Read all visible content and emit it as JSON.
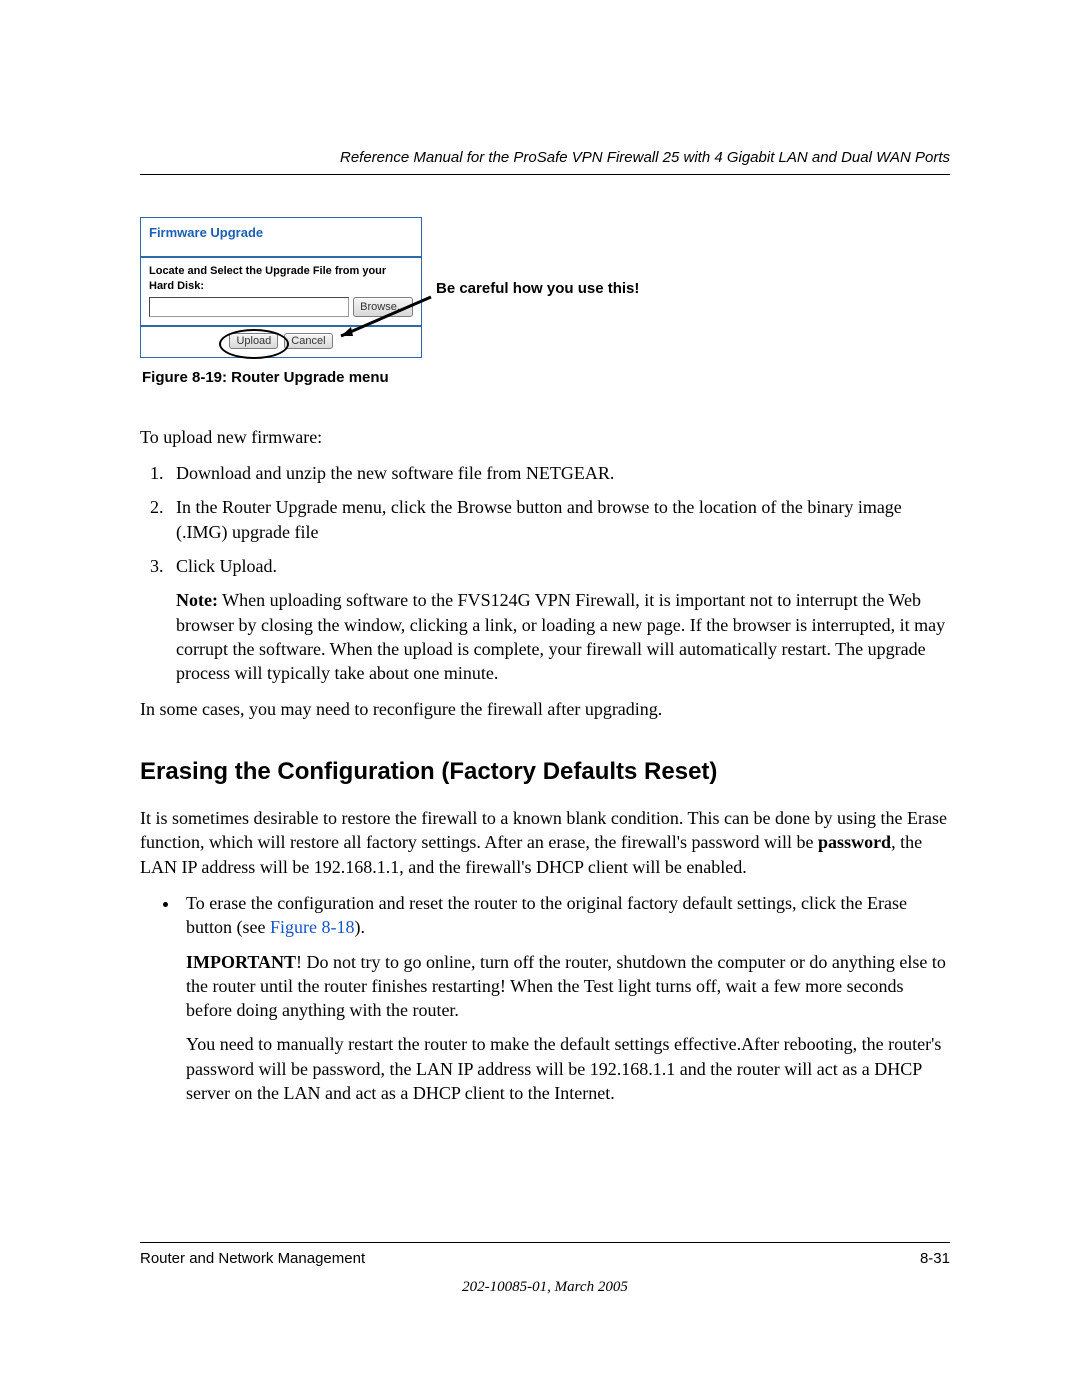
{
  "header": {
    "running_head": "Reference Manual for the ProSafe VPN Firewall 25 with 4 Gigabit LAN and Dual WAN Ports"
  },
  "screenshot": {
    "title": "Firmware Upgrade",
    "locate_label": "Locate and Select the Upgrade File from your Hard Disk:",
    "browse_btn": "Browse...",
    "upload_btn": "Upload",
    "cancel_btn": "Cancel"
  },
  "callout": "Be careful how you use this!",
  "figure_caption": "Figure 8-19:  Router Upgrade menu",
  "intro": "To upload new firmware:",
  "steps": {
    "s1": "Download and unzip the new software file from NETGEAR.",
    "s2": "In the Router Upgrade menu, click the Browse button and browse to the location of the binary image (.IMG) upgrade file",
    "s3": "Click Upload.",
    "s3_note_label": "Note:",
    "s3_note_body": " When uploading software to the FVS124G VPN Firewall, it is important not to interrupt the Web browser by closing the window, clicking a link, or loading a new page. If the browser is interrupted, it may corrupt the software. When the upload is complete, your firewall will automatically restart. The upgrade process will typically take about one minute."
  },
  "after_steps": "In some cases, you may need to reconfigure the firewall after upgrading.",
  "section_heading": "Erasing the Configuration (Factory Defaults Reset)",
  "section_para_pre": "It is sometimes desirable to restore the firewall to a known blank condition. This can be done by using the Erase function, which will restore all factory settings. After an erase, the firewall's password will be ",
  "section_para_bold": "password",
  "section_para_post": ", the LAN IP address will be 192.168.1.1, and the firewall's DHCP client will be enabled.",
  "bullet": {
    "lead": "To erase the configuration and reset the router to the original factory default settings, click the Erase button (see ",
    "link_text": "Figure 8-18",
    "lead_end": ").",
    "important_label": "IMPORTANT",
    "important_body": "! Do not try to go online, turn off the router, shutdown the computer or do anything else to the router until the router finishes restarting! When the Test light turns off, wait a few more seconds before doing anything with the router.",
    "para3": "You need to manually restart the router to make the default settings effective.After rebooting, the router's password will be password, the LAN IP address will be 192.168.1.1 and the router will act as a DHCP server on the LAN and act as a DHCP client to the Internet."
  },
  "footer": {
    "left": "Router and Network Management",
    "right": "8-31",
    "sub": "202-10085-01, March 2005"
  }
}
